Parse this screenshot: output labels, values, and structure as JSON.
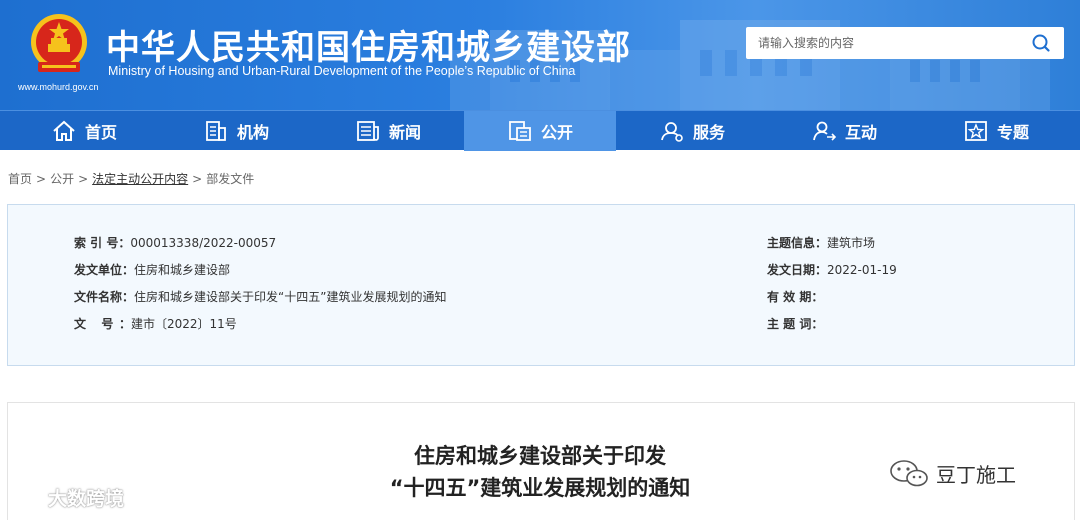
{
  "header": {
    "title_cn": "中华人民共和国住房和城乡建设部",
    "title_en": "Ministry of Housing and Urban-Rural Development of the People’s Republic of China",
    "site_url": "www.mohurd.gov.cn",
    "search_placeholder": "请输入搜索的内容",
    "colors": {
      "primary": "#1e6fd0",
      "nav": "#1c67c7",
      "nav_active": "#4f95e6"
    }
  },
  "nav": {
    "items": [
      {
        "label": "首页",
        "icon": "home-icon"
      },
      {
        "label": "机构",
        "icon": "building-icon"
      },
      {
        "label": "新闻",
        "icon": "newspaper-icon"
      },
      {
        "label": "公开",
        "icon": "document-icon",
        "active": true
      },
      {
        "label": "服务",
        "icon": "user-service-icon"
      },
      {
        "label": "互动",
        "icon": "interaction-icon"
      },
      {
        "label": "专题",
        "icon": "star-icon"
      }
    ]
  },
  "breadcrumb": {
    "items": [
      "首页",
      "公开",
      "法定主动公开内容",
      "部发文件"
    ],
    "separator": ">"
  },
  "info": {
    "index_label": "索 引 号：",
    "index_value": "000013338/2022-00057",
    "issuer_label": "发文单位：",
    "issuer_value": "住房和城乡建设部",
    "docname_label": "文件名称：",
    "docname_value": "住房和城乡建设部关于印发“十四五”建筑业发展规划的通知",
    "docno_label": "文 号：",
    "docno_value": "建市〔2022〕11号",
    "topic_label": "主题信息：",
    "topic_value": "建筑市场",
    "date_label": "发文日期：",
    "date_value": "2022-01-19",
    "validity_label": "有 效 期：",
    "validity_value": "",
    "keywords_label": "主 题 词：",
    "keywords_value": ""
  },
  "article": {
    "title_line1": "住房和城乡建设部关于印发",
    "title_line2": "“十四五”建筑业发展规划的通知"
  },
  "watermarks": {
    "left": "大数跨境",
    "right": "豆丁施工"
  }
}
